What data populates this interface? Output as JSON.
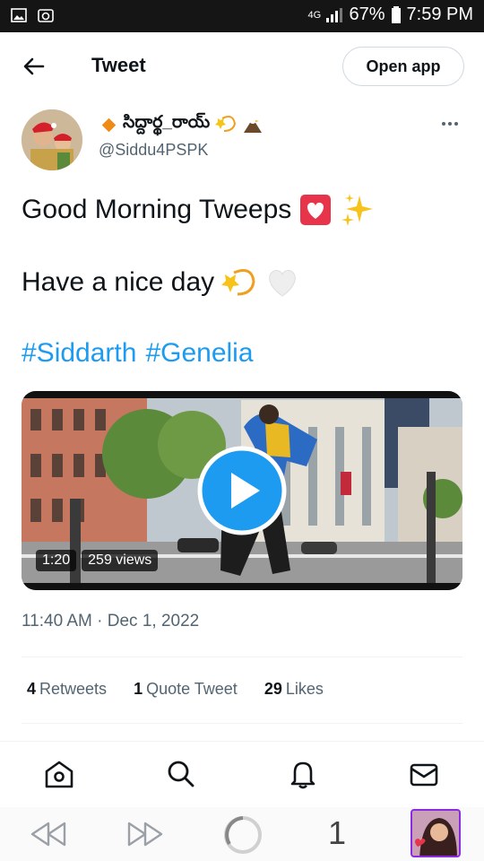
{
  "status_bar": {
    "network": "4G",
    "battery": "67%",
    "time": "7:59 PM"
  },
  "header": {
    "title": "Tweet",
    "open_app_label": "Open app"
  },
  "author": {
    "display_name": "సిద్దార్థ_రాయ్",
    "handle": "@Siddu4PSPK"
  },
  "tweet": {
    "line1": "Good Morning Tweeps",
    "line2": "Have a nice day",
    "hashtags": [
      "#Siddarth",
      "#Genelia"
    ],
    "timestamp": "11:40 AM · Dec 1, 2022"
  },
  "video": {
    "duration": "1:20",
    "views": "259 views"
  },
  "stats": {
    "retweets_count": "4",
    "retweets_label": "Retweets",
    "quotes_count": "1",
    "quotes_label": "Quote Tweet",
    "likes_count": "29",
    "likes_label": "Likes"
  },
  "browser": {
    "tab_count": "1"
  },
  "icons": {
    "play": "play-icon",
    "home": "home-icon",
    "search": "search-icon",
    "bell": "bell-icon",
    "mail": "mail-icon"
  },
  "colors": {
    "link": "#1d9bf0",
    "text": "#0f1419",
    "secondary": "#536471"
  }
}
